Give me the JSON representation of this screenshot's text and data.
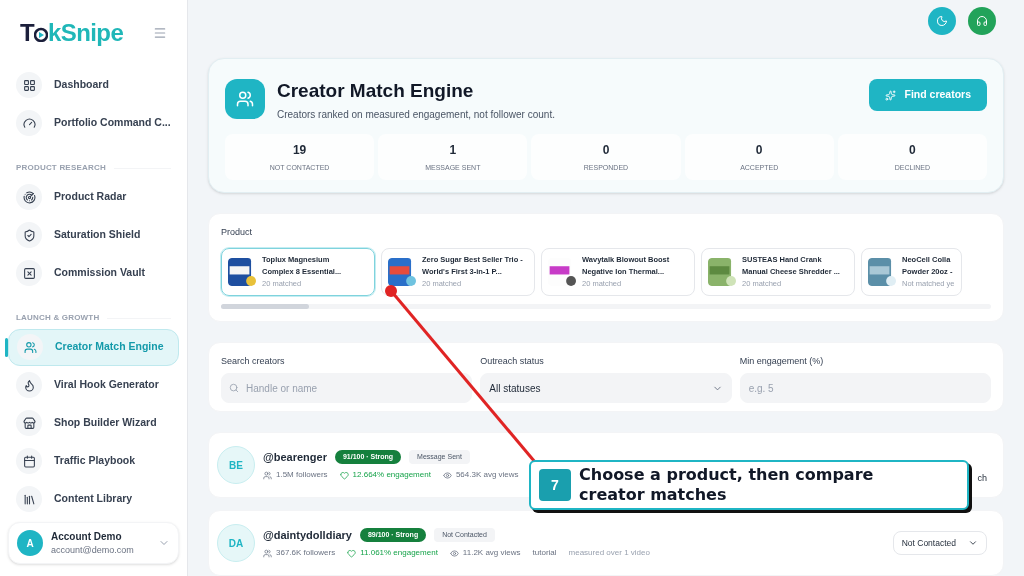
{
  "logo": {
    "start": "T",
    "end": "kSnipe"
  },
  "sidebar": {
    "sections": [
      {
        "items": [
          {
            "label": "Dashboard",
            "selected": false
          },
          {
            "label": "Portfolio Command C...",
            "selected": false
          }
        ]
      },
      {
        "heading": "PRODUCT RESEARCH",
        "items": [
          {
            "label": "Product Radar",
            "selected": false
          },
          {
            "label": "Saturation Shield",
            "selected": false
          },
          {
            "label": "Commission Vault",
            "selected": false
          }
        ]
      },
      {
        "heading": "LAUNCH & GROWTH",
        "items": [
          {
            "label": "Creator Match Engine",
            "selected": true
          },
          {
            "label": "Viral Hook Generator",
            "selected": false
          },
          {
            "label": "Shop Builder Wizard",
            "selected": false
          },
          {
            "label": "Traffic Playbook",
            "selected": false
          },
          {
            "label": "Content Library",
            "selected": false
          }
        ]
      }
    ],
    "account": {
      "initial": "A",
      "name": "Account Demo",
      "email": "account@demo.com"
    }
  },
  "header": {
    "title": "Creator Match Engine",
    "subtitle": "Creators ranked on measured engagement, not follower count.",
    "button": "Find creators"
  },
  "stats": [
    {
      "value": "19",
      "label": "NOT CONTACTED"
    },
    {
      "value": "1",
      "label": "MESSAGE SENT"
    },
    {
      "value": "0",
      "label": "RESPONDED"
    },
    {
      "value": "0",
      "label": "ACCEPTED"
    },
    {
      "value": "0",
      "label": "DECLINED"
    }
  ],
  "products": {
    "label": "Product",
    "items": [
      {
        "lines": [
          "Toplux Magnesium",
          "Complex 8 Essential..."
        ],
        "meta": "20 matched",
        "selected": true
      },
      {
        "lines": [
          "Zero Sugar Best Seller Trio -",
          "World's First 3-in-1 P..."
        ],
        "meta": "20 matched",
        "selected": false
      },
      {
        "lines": [
          "Wavytalk Blowout Boost",
          "Negative Ion Thermal..."
        ],
        "meta": "20 matched",
        "selected": false
      },
      {
        "lines": [
          "SUSTEAS Hand Crank",
          "Manual Cheese Shredder ..."
        ],
        "meta": "20 matched",
        "selected": false
      },
      {
        "lines": [
          "NeoCell Colla",
          "Powder 20oz -"
        ],
        "meta": "Not matched ye",
        "selected": false
      }
    ]
  },
  "filters": [
    {
      "kind": "search",
      "label": "Search creators",
      "placeholder": "Handle or name"
    },
    {
      "kind": "select",
      "label": "Outreach status",
      "value": "All statuses"
    },
    {
      "kind": "input",
      "label": "Min engagement (%)",
      "placeholder": "e.g. 5"
    }
  ],
  "creators": [
    {
      "initials": "BE",
      "handle": "@bearenger",
      "score": "91/100 · Strong",
      "status": "Message Sent",
      "followers": "1.5M followers",
      "engagement": "12.664% engagement",
      "views": "564.3K avg views",
      "tail": "ch"
    },
    {
      "initials": "DA",
      "handle": "@daintydolldiary",
      "score": "89/100 · Strong",
      "status": "Not Contacted",
      "followers": "367.6K followers",
      "engagement": "11.061% engagement",
      "views": "11.2K avg views",
      "tag": "tutorial",
      "note": "measured over 1 video",
      "dropdown": "Not Contacted"
    }
  ],
  "callout": {
    "step": "7",
    "text": "Choose a product, then compare creator matches"
  }
}
